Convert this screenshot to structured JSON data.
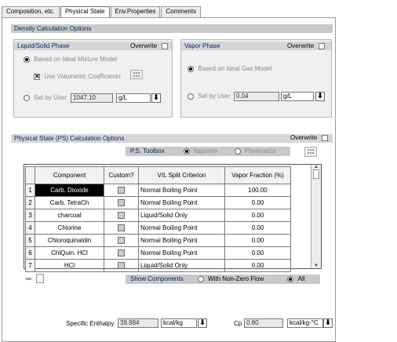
{
  "tabs": [
    "Composition, etc.",
    "Physical State",
    "Env.Properties",
    "Comments"
  ],
  "density": {
    "header": "Density Calculation Options",
    "liquid": {
      "title": "Liquid/Solid Phase",
      "overwrite": "Overwrite",
      "option1": "Based on Ideal Mixture Model",
      "option2": "Use Volumetric Coefficients",
      "option3": "Set by User",
      "value": "1047.10",
      "unit": "g/L"
    },
    "vapor": {
      "title": "Vapor Phase",
      "overwrite": "Overwrite",
      "option1": "Based on Ideal Gas Model",
      "option2": "Set by User",
      "value": "0.04",
      "unit": "g/L"
    }
  },
  "ps": {
    "header": "Physical State (PS) Calculation Options",
    "overwrite": "Overwrite",
    "toolbox": "P.S. Toolbox",
    "opt_a": "Vaporize",
    "opt_b": "Physicalize",
    "columns": [
      "Component",
      "Custom?",
      "V/L Split Criterion",
      "Vapor Fraction (%)"
    ],
    "rows": [
      {
        "n": "1",
        "component": "Carb. Dioxide",
        "criterion": "Normal Boiling Point",
        "vf": "100.00"
      },
      {
        "n": "2",
        "component": "Carb. TetraCh",
        "criterion": "Normal Boiling Point",
        "vf": "0.00"
      },
      {
        "n": "3",
        "component": "charcoal",
        "criterion": "Liquid/Solid Only",
        "vf": "0.00"
      },
      {
        "n": "4",
        "component": "Chlorine",
        "criterion": "Normal Boiling Point",
        "vf": "0.00"
      },
      {
        "n": "5",
        "component": "Chloroquinaldin",
        "criterion": "Normal Boiling Point",
        "vf": "0.00"
      },
      {
        "n": "6",
        "component": "ChlQuin. HCl",
        "criterion": "Normal Boiling Point",
        "vf": "0.00"
      },
      {
        "n": "7",
        "component": "HCl",
        "criterion": "Liquid/Solid Only",
        "vf": "0.00"
      }
    ],
    "show_label": "Show Components",
    "show_nonzero": "With Non-Zero Flow",
    "show_all": "All"
  },
  "bottom": {
    "enthalpy_label": "Specific Enthalpy",
    "enthalpy_value": "39.984",
    "enthalpy_unit": "kcal/kg",
    "cp_label": "Cp",
    "cp_value": "0.80",
    "cp_unit": "kcal/kg-°C"
  }
}
